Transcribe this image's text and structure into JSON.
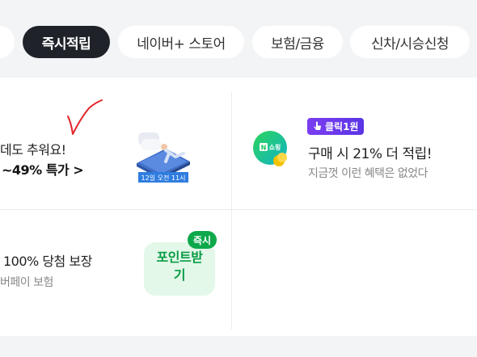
{
  "tabs": {
    "active": "즉시적립",
    "items": [
      "네이버+ 스토어",
      "보험/금융",
      "신차/시승신청"
    ]
  },
  "left_top": {
    "line1": "데도 추워요!",
    "line2": "~49% 특가 >",
    "thumb_caption": "12일 오전 11시"
  },
  "right_top": {
    "badge": "클릭1원",
    "logo_letter": "N",
    "logo_text": "쇼핑",
    "title": "구매 시 21% 더 적립!",
    "subtitle": "지금껏 이런 혜택은 없었다"
  },
  "left_bottom": {
    "title": "100% 당첨 보장",
    "subtitle": "버페이 보험",
    "cta_line1": "포인트받",
    "cta_line2": "기",
    "badge": "즉시"
  },
  "colors": {
    "active_tab_bg": "#1f2329",
    "badge_purple": "#6a38ea",
    "cta_green": "#0a9b45",
    "annotation_red": "#e0262a"
  }
}
